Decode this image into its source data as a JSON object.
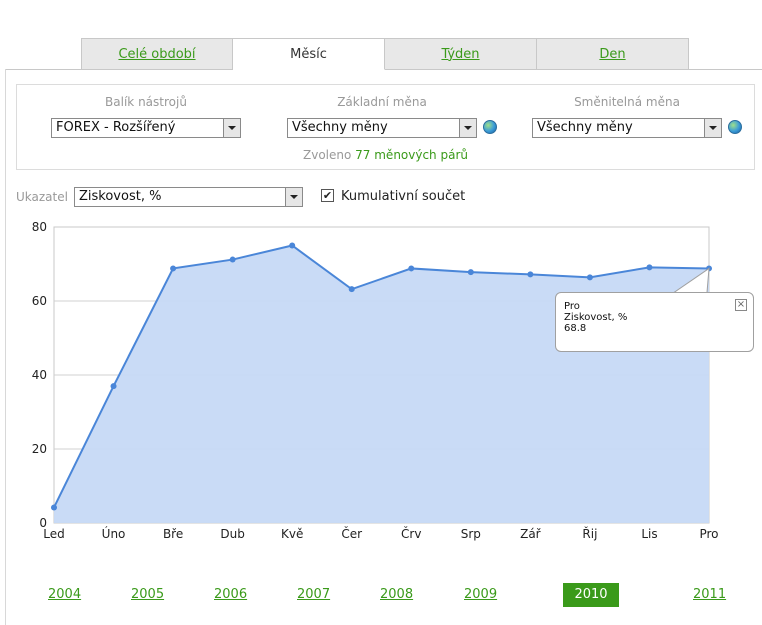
{
  "tabs": [
    {
      "label": "Celé období",
      "active": false
    },
    {
      "label": "Měsíc",
      "active": true
    },
    {
      "label": "Týden",
      "active": false
    },
    {
      "label": "Den",
      "active": false
    }
  ],
  "selectors": {
    "toolkit": {
      "label": "Balík nástrojů",
      "value": "FOREX - Rozšířený"
    },
    "base_currency": {
      "label": "Základní měna",
      "value": "Všechny měny"
    },
    "quote_currency": {
      "label": "Směnitelná měna",
      "value": "Všechny měny"
    },
    "selected_prefix": "Zvoleno",
    "selected_count": "77 měnových párů"
  },
  "indicator": {
    "label": "Ukazatel",
    "value": "Ziskovost, %",
    "cumulative_label": "Kumulativní součet",
    "cumulative_checked": true,
    "check_glyph": "✔"
  },
  "chart_data": {
    "type": "area",
    "categories": [
      "Led",
      "Úno",
      "Bře",
      "Dub",
      "Kvě",
      "Čer",
      "Črv",
      "Srp",
      "Zář",
      "Řij",
      "Lis",
      "Pro"
    ],
    "series": [
      {
        "values": [
          4.2,
          37.0,
          68.8,
          71.2,
          75.0,
          63.2,
          68.8,
          67.8,
          67.2,
          66.4,
          69.1,
          68.8
        ]
      }
    ],
    "yticks": [
      0,
      20,
      40,
      60,
      80
    ],
    "ylim": [
      0,
      80
    ],
    "grid": true,
    "fill_color": "#c6d9f6",
    "line_color": "#4a86d8"
  },
  "tooltip": {
    "category": "Pro",
    "series": "Ziskovost, %",
    "value": "68.8",
    "close_glyph": "×"
  },
  "years": [
    {
      "label": "2004",
      "active": false
    },
    {
      "label": "2005",
      "active": false
    },
    {
      "label": "2006",
      "active": false
    },
    {
      "label": "2007",
      "active": false
    },
    {
      "label": "2008",
      "active": false
    },
    {
      "label": "2009",
      "active": false
    },
    {
      "label": "2010",
      "active": true
    },
    {
      "label": "2011",
      "active": false
    }
  ]
}
